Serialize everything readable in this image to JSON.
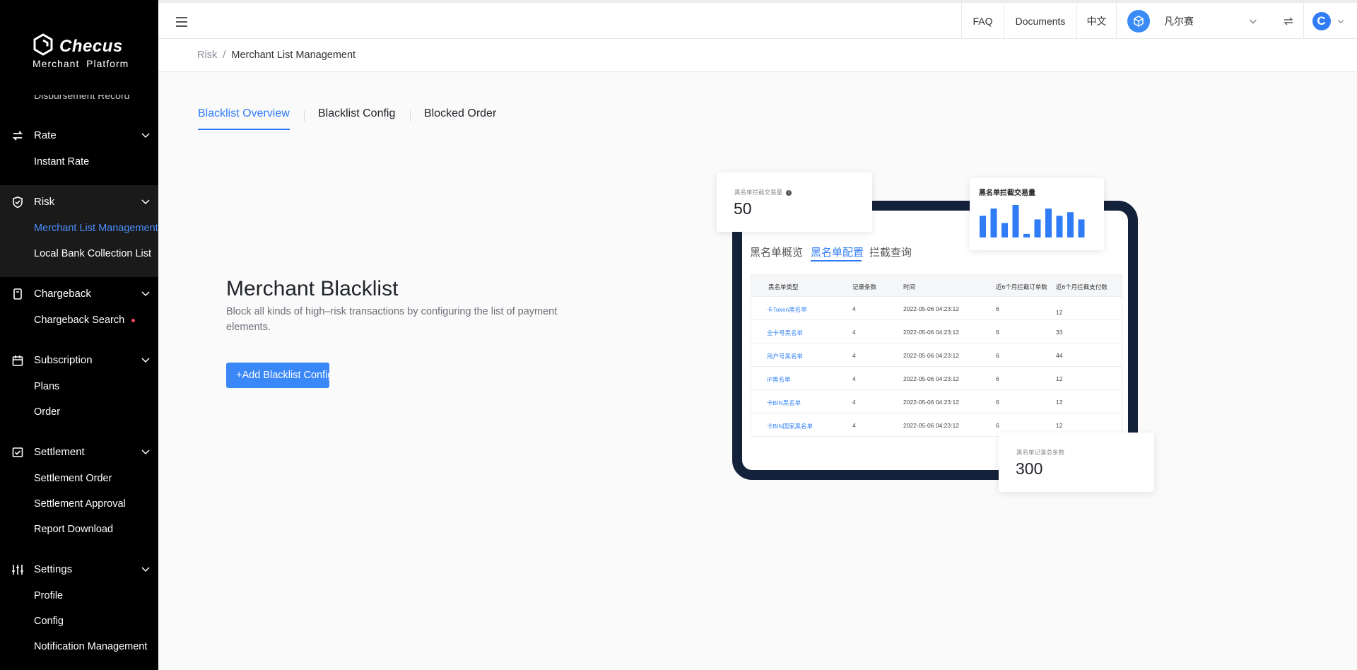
{
  "sidebar": {
    "brand": "Checus",
    "brand_sub": "Merchant  Platform",
    "cut_item": "Disbursement Record",
    "groups": [
      {
        "label": "Rate",
        "icon": "exchange-icon",
        "items": [
          {
            "label": "Instant Rate"
          }
        ]
      },
      {
        "label": "Risk",
        "icon": "shield-check-icon",
        "items": [
          {
            "label": "Merchant List Management",
            "active": true
          },
          {
            "label": "Local Bank Collection List"
          }
        ]
      },
      {
        "label": "Chargeback",
        "icon": "phone-card-icon",
        "items": [
          {
            "label": "Chargeback Search",
            "dot": true
          }
        ]
      },
      {
        "label": "Subscription",
        "icon": "calendar-icon",
        "items": [
          {
            "label": "Plans"
          },
          {
            "label": "Order"
          }
        ]
      },
      {
        "label": "Settlement",
        "icon": "checklist-icon",
        "items": [
          {
            "label": "Settlement Order"
          },
          {
            "label": "Settlement Approval"
          },
          {
            "label": "Report Download"
          }
        ]
      },
      {
        "label": "Settings",
        "icon": "sliders-icon",
        "items": [
          {
            "label": "Profile"
          },
          {
            "label": "Config"
          },
          {
            "label": "Notification Management"
          }
        ]
      }
    ]
  },
  "topbar": {
    "faq": "FAQ",
    "documents": "Documents",
    "language": "中文",
    "merchant_name": "凡尔赛",
    "avatar_letter": "C"
  },
  "breadcrumb": {
    "parent": "Risk",
    "separator": "/",
    "current": "Merchant List Management"
  },
  "tabs": [
    "Blacklist Overview",
    "Blacklist Config",
    "Blocked Order"
  ],
  "hero": {
    "title": "Merchant Blacklist",
    "description": "Block all kinds of high–risk transactions by configuring the list of payment elements.",
    "button_label": "+Add Blacklist Config"
  },
  "illustration": {
    "card_intercept_title": "黑名单拦截交易量",
    "card_intercept_value": "50",
    "bar_card_title": "黑名单拦截交易量",
    "bar_values": [
      6,
      8,
      4,
      9,
      1,
      5,
      8,
      6,
      7,
      5
    ],
    "card_total_title": "黑名单记录总条数",
    "card_total_value": "300",
    "mini_tabs": [
      "黑名单概览",
      "黑名单配置",
      "拦截查询"
    ],
    "table_headers": [
      "黑名单类型",
      "记录条数",
      "时间",
      "近6个月拦截订单数",
      "近6个月拦截支付数"
    ],
    "table_rows": [
      [
        "卡Token黑名单",
        "4",
        "2022-05-06 04:23:12",
        "6",
        "12"
      ],
      [
        "全卡号黑名单",
        "4",
        "2022-05-06 04:23:12",
        "6",
        "33"
      ],
      [
        "用户号黑名单",
        "4",
        "2022-05-06 04:23:12",
        "6",
        "44"
      ],
      [
        "IP黑名单",
        "4",
        "2022-05-06 04:23:12",
        "6",
        "12"
      ],
      [
        "卡BIN黑名单",
        "4",
        "2022-05-06 04:23:12",
        "6",
        "12"
      ],
      [
        "卡BIN国家黑名单",
        "4",
        "2022-05-06 04:23:12",
        "6",
        "12"
      ]
    ]
  },
  "colors": {
    "accent": "#2f7cf6",
    "sidebar_bg": "#000000",
    "tablet_frame": "#14213a",
    "badge_dot": "#f5475c"
  }
}
